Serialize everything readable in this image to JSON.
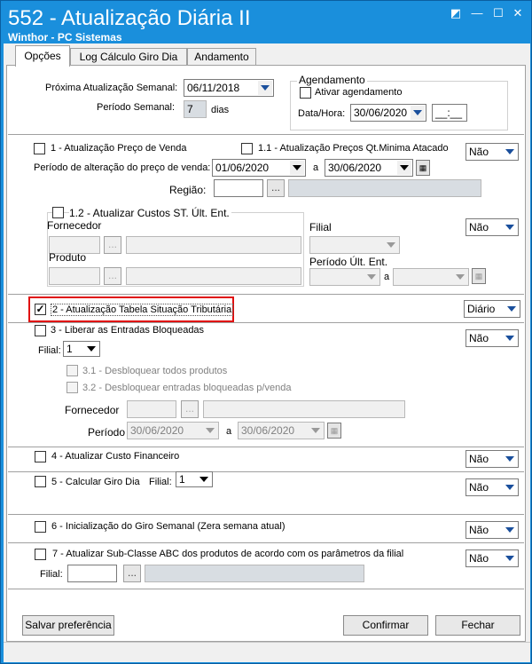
{
  "window": {
    "title": "552 - Atualização Diária II",
    "subtitle": "Winthor - PC Sistemas"
  },
  "tabs": [
    {
      "label": "Opções",
      "active": true
    },
    {
      "label": "Log Cálculo Giro Dia",
      "active": false
    },
    {
      "label": "Andamento",
      "active": false
    }
  ],
  "top": {
    "proxima_label": "Próxima Atualização Semanal:",
    "proxima_value": "06/11/2018",
    "periodo_label": "Período Semanal:",
    "periodo_value": "7",
    "periodo_unit": "dias",
    "agendamento_title": "Agendamento",
    "ativar_label": "Ativar agendamento",
    "datahora_label": "Data/Hora:",
    "datahora_date": "30/06/2020",
    "datahora_time": "__:__"
  },
  "s1": {
    "label": "1 - Atualização Preço de Venda",
    "label11": "1.1 - Atualização Preços Qt.Minima Atacado",
    "combo": "Não",
    "periodo_label": "Período de alteração do preço de venda:",
    "date_from": "01/06/2020",
    "a": "a",
    "date_to": "30/06/2020",
    "regiao_label": "Região:",
    "regiao_value": "",
    "dots": "...",
    "label12": "1.2 - Atualizar Custos ST. Últ. Ent.",
    "combo12": "Não",
    "fornecedor_label": "Fornecedor",
    "filial_label": "Filial",
    "produto_label": "Produto",
    "periodo_ult_label": "Período Últ. Ent.",
    "a2": "a"
  },
  "s2": {
    "label": "2 - Atualização Tabela Situação Tributária",
    "checked": true,
    "combo": "Diário"
  },
  "s3": {
    "label": "3 - Liberar as Entradas Bloqueadas",
    "combo": "Não",
    "filial_label": "Filial:",
    "filial_value": "1",
    "l31": "3.1 - Desbloquear todos produtos",
    "l32": "3.2 - Desbloquear entradas bloqueadas p/venda",
    "fornecedor_label": "Fornecedor",
    "periodo_label": "Período",
    "date_from": "30/06/2020",
    "a": "a",
    "date_to": "30/06/2020",
    "dots": "..."
  },
  "s4": {
    "label": "4 - Atualizar Custo Financeiro",
    "combo": "Não"
  },
  "s5": {
    "label": "5 - Calcular Giro Dia",
    "filial_label": "Filial:",
    "filial_value": "1",
    "combo": "Não"
  },
  "s6": {
    "label": "6 - Inicialização do Giro Semanal (Zera semana atual)",
    "combo": "Não"
  },
  "s7": {
    "label": "7 - Atualizar Sub-Classe ABC dos produtos de acordo com os parâmetros da filial",
    "combo": "Não",
    "filial_label": "Filial:",
    "dots": "..."
  },
  "buttons": {
    "salvar": "Salvar preferência",
    "confirmar": "Confirmar",
    "fechar": "Fechar"
  }
}
